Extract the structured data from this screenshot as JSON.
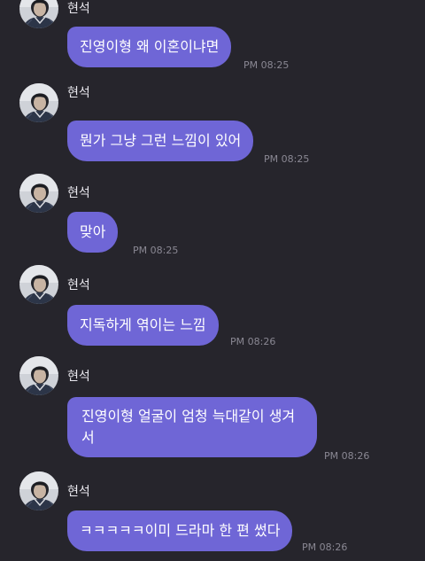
{
  "messages": [
    {
      "sender": "현석",
      "text": "진영이형 왜 이혼이냐면",
      "time": "PM 08:25"
    },
    {
      "sender": "현석",
      "text": "뭔가 그냥 그런 느낌이 있어",
      "time": "PM 08:25"
    },
    {
      "sender": "현석",
      "text": "맞아",
      "time": "PM 08:25"
    },
    {
      "sender": "현석",
      "text": "지독하게 엮이는 느낌",
      "time": "PM 08:26"
    },
    {
      "sender": "현석",
      "text": "진영이형 얼굴이 엄청 늑대같이 생겨서",
      "time": "PM 08:26"
    },
    {
      "sender": "현석",
      "text": "ㅋㅋㅋㅋㅋ이미 드라마 한 편 썼다",
      "time": "PM 08:26"
    }
  ],
  "colors": {
    "background": "#26252c",
    "bubble": "#6f66d6",
    "time_text": "#8a8893"
  },
  "icons": {
    "avatar": "profile-photo"
  }
}
